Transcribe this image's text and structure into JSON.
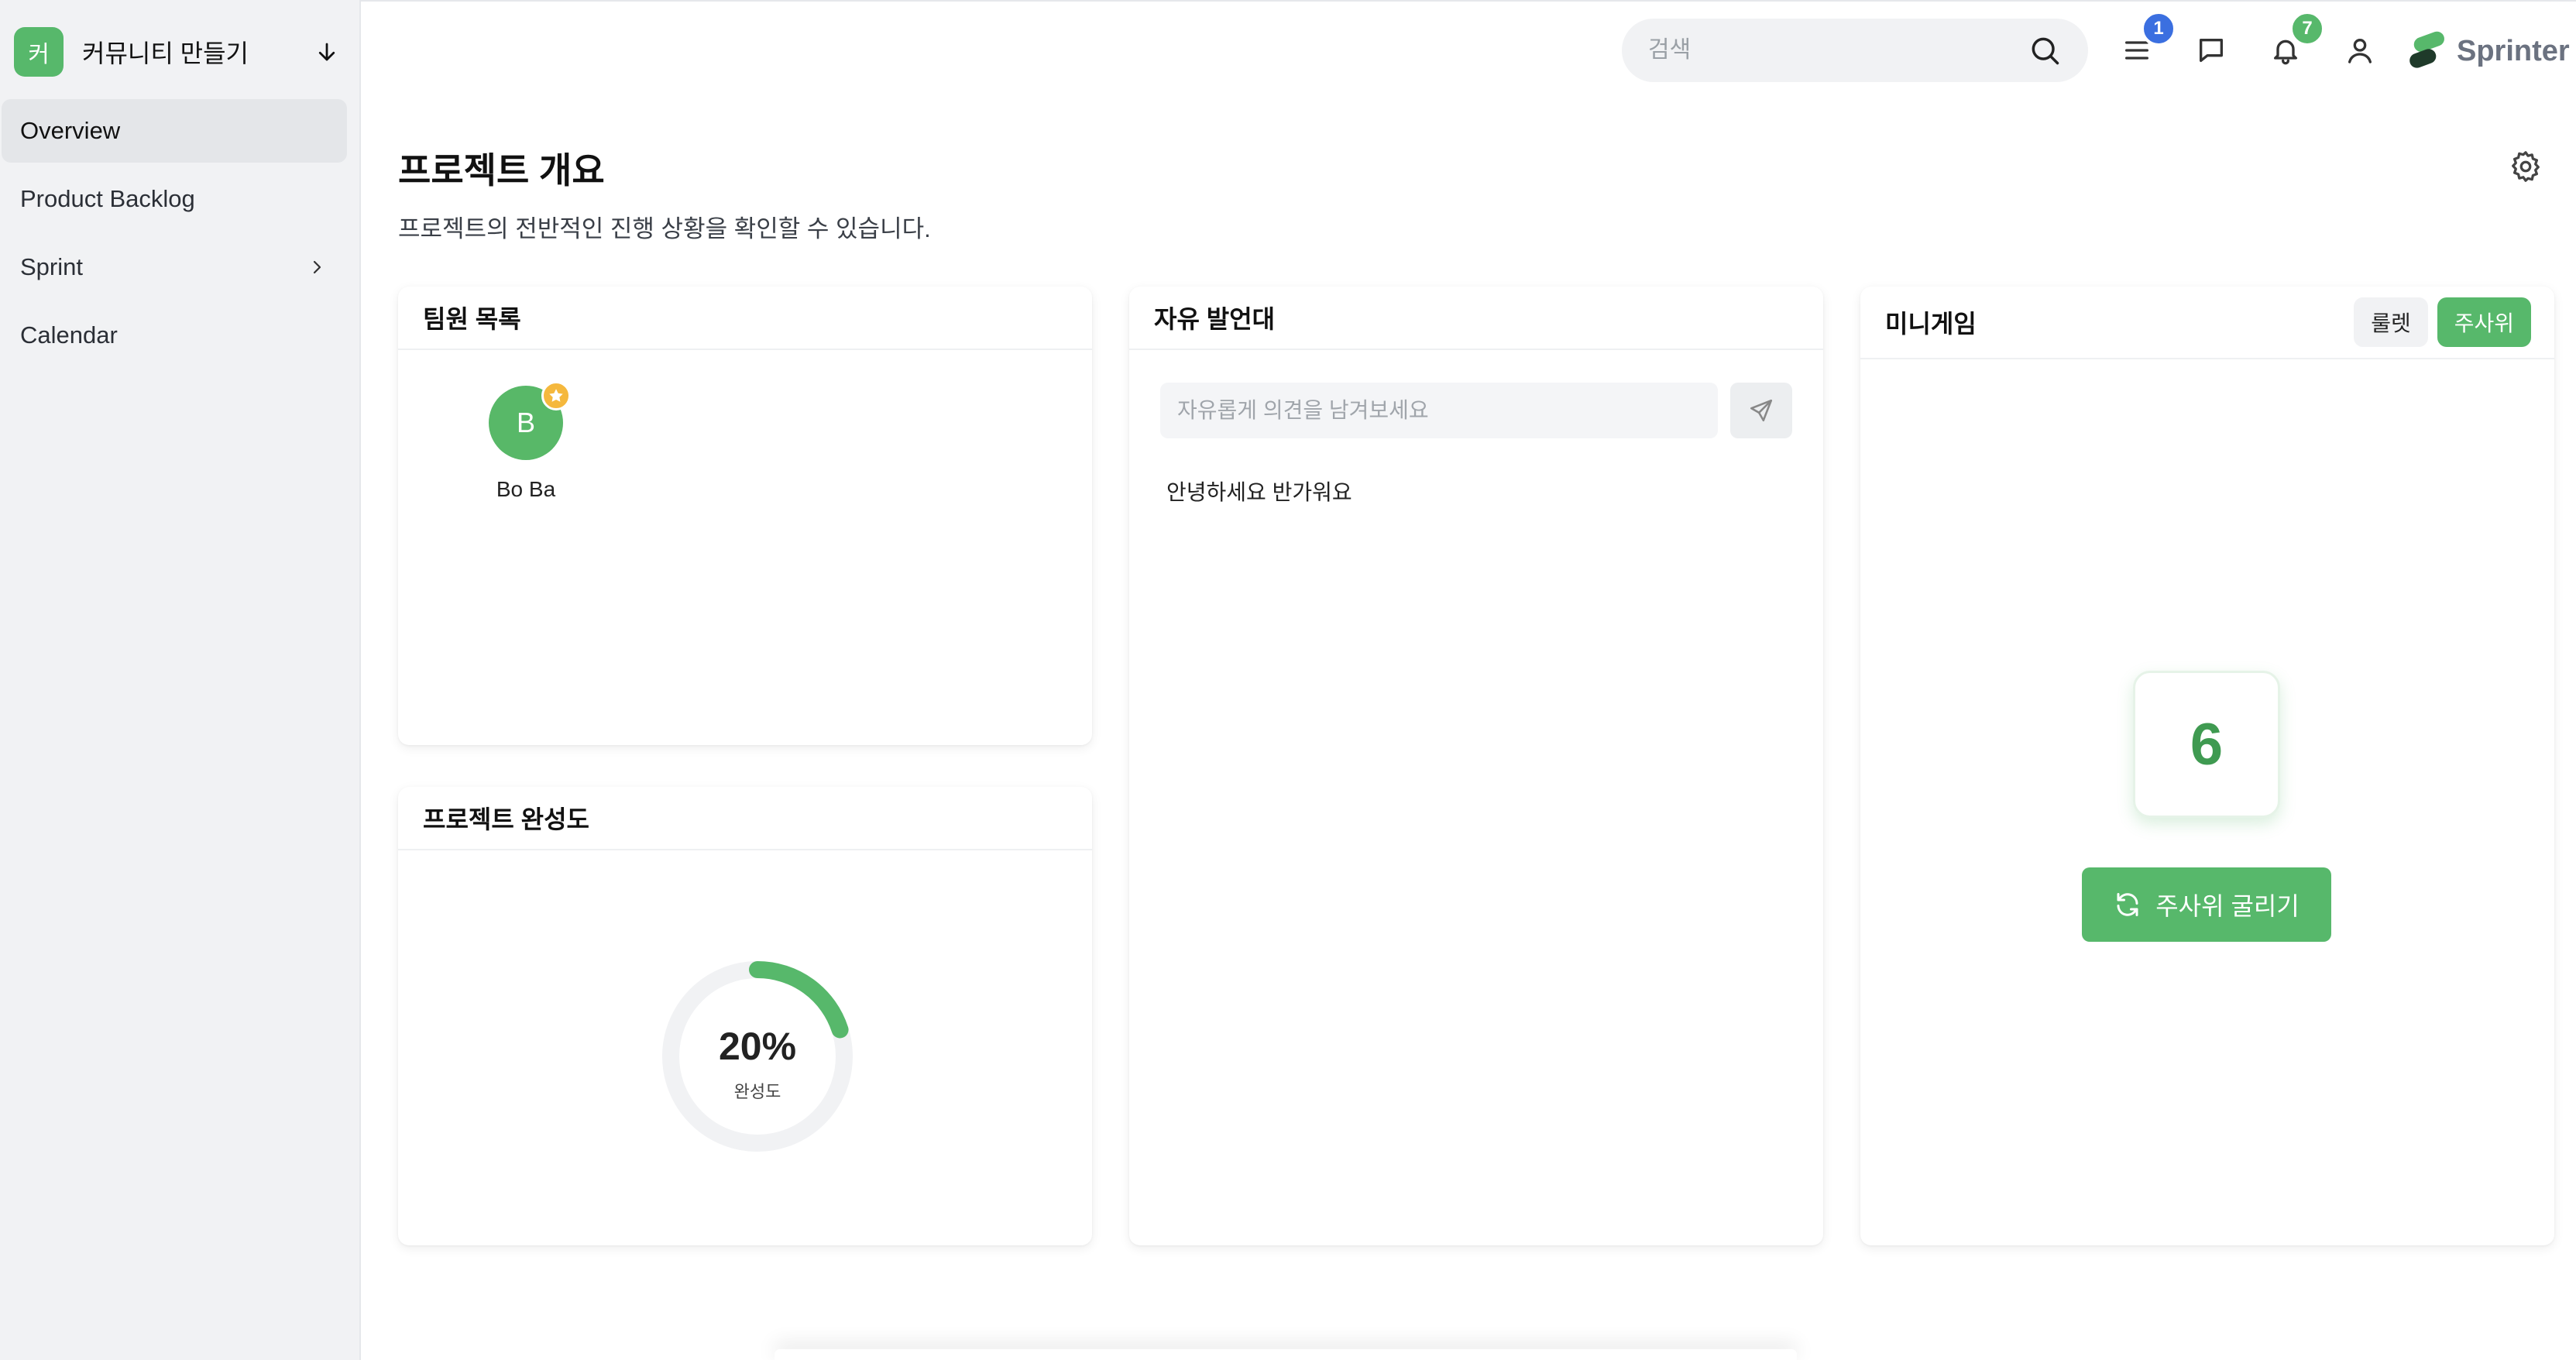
{
  "sidebar": {
    "project": {
      "badge": "커",
      "name": "커뮤니티 만들기"
    },
    "items": [
      {
        "label": "Overview"
      },
      {
        "label": "Product Backlog"
      },
      {
        "label": "Sprint"
      },
      {
        "label": "Calendar"
      }
    ]
  },
  "topbar": {
    "search_placeholder": "검색",
    "menu_badge": "1",
    "notification_badge": "7",
    "logo_text": "Sprinter",
    "colors": {
      "menu_badge": "#3b6fe0",
      "notification_badge": "#57b86b"
    }
  },
  "page": {
    "title": "프로젝트 개요",
    "subtitle": "프로젝트의 전반적인 진행 상황을 확인할 수 있습니다."
  },
  "team": {
    "title": "팀원 목록",
    "members": [
      {
        "initial": "B",
        "name": "Bo Ba"
      }
    ]
  },
  "progress": {
    "title": "프로젝트 완성도",
    "value_text": "20%",
    "percent": 20,
    "label": "완성도"
  },
  "board": {
    "title": "자유 발언대",
    "placeholder": "자유롭게 의견을 남겨보세요",
    "messages": [
      "안녕하세요 반가워요"
    ]
  },
  "minigame": {
    "title": "미니게임",
    "tabs": [
      {
        "label": "룰렛"
      },
      {
        "label": "주사위"
      }
    ],
    "dice_value": "6",
    "roll_label": "주사위 굴리기"
  },
  "theme": {
    "accent": "#57b86b",
    "sidebar_bg": "#f1f2f4"
  }
}
